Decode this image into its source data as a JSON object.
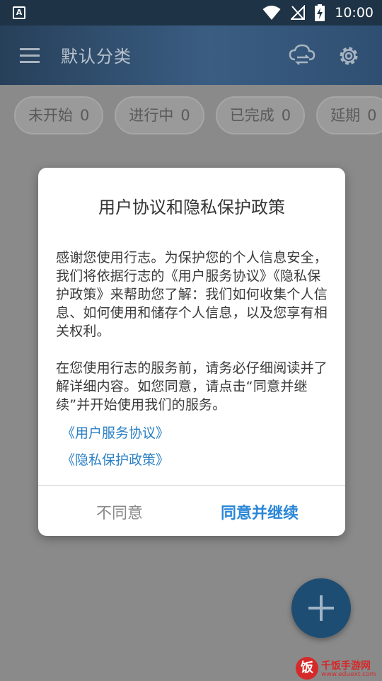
{
  "statusbar": {
    "time": "10:00",
    "icons": [
      "accessibility-a-icon",
      "wifi-icon",
      "no-signal-icon",
      "battery-charging-icon"
    ]
  },
  "appbar": {
    "title": "默认分类",
    "icons": [
      "menu-icon",
      "cloud-sync-icon",
      "gear-icon"
    ]
  },
  "chips": [
    {
      "label": "未开始",
      "count": "0"
    },
    {
      "label": "进行中",
      "count": "0"
    },
    {
      "label": "已完成",
      "count": "0"
    },
    {
      "label": "延期",
      "count": "0"
    }
  ],
  "dialog": {
    "title": "用户协议和隐私保护政策",
    "paragraph1": "感谢您使用行志。为保护您的个人信息安全，我们将依据行志的《用户服务协议》《隐私保护政策》来帮助您了解：我们如何收集个人信息、如何使用和储存个人信息，以及您享有相关权利。",
    "paragraph2": "在您使用行志的服务前，请务必仔细阅读并了解详细内容。如您同意，请点击“同意并继续”并开始使用我们的服务。",
    "link_terms": "《用户服务协议》",
    "link_privacy": "《隐私保护政策》",
    "disagree_label": "不同意",
    "agree_label": "同意并继续"
  },
  "fab": {
    "icon": "plus-icon"
  },
  "watermark": {
    "logo_char": "饭",
    "name": "千饭手游网",
    "url": "www.eduext.com"
  },
  "colors": {
    "appbar_start": "#27405a",
    "appbar_end": "#3a5d82",
    "link": "#2a7fc4",
    "agree": "#2a87d8",
    "fab": "#1d4d73",
    "watermark": "#d42a2a"
  }
}
